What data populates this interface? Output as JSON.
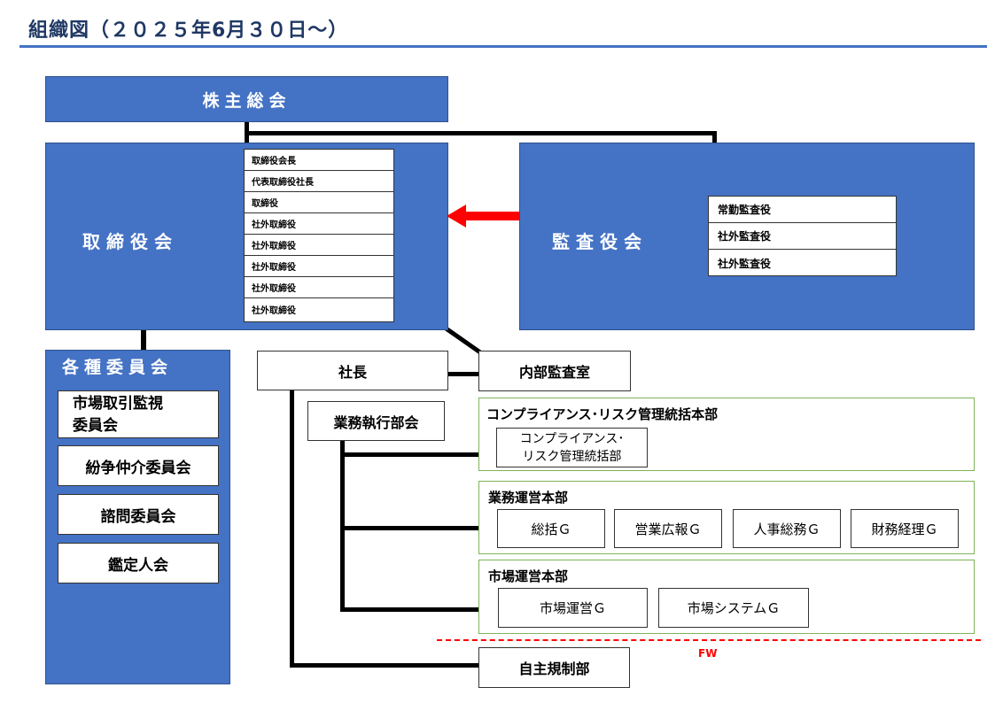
{
  "title": "組織図（２０２５年6月３０日～）",
  "shareholders": "株主総会",
  "board": {
    "label": "取締役会",
    "members": [
      "取締役会長",
      "代表取締役社長",
      "取締役",
      "社外取締役",
      "社外取締役",
      "社外取締役",
      "社外取締役",
      "社外取締役"
    ]
  },
  "audit_board": {
    "label": "監査役会",
    "members": [
      "常勤監査役",
      "社外監査役",
      "社外監査役"
    ]
  },
  "committees": {
    "label": "各種委員会",
    "items": [
      "市場取引監視\n委員会",
      "紛争仲介委員会",
      "諮問委員会",
      "鑑定人会"
    ]
  },
  "president": "社長",
  "internal_audit": "内部監査室",
  "exec_committee": "業務執行部会",
  "compliance": {
    "title": "コンプライアンス･リスク管理統括本部",
    "sub": "コンプライアンス･\nリスク管理統括部"
  },
  "operations": {
    "title": "業務運営本部",
    "groups": [
      "総括Ｇ",
      "営業広報Ｇ",
      "人事総務Ｇ",
      "財務経理Ｇ"
    ]
  },
  "market": {
    "title": "市場運営本部",
    "groups": [
      "市場運営Ｇ",
      "市場システムＧ"
    ]
  },
  "fw_label": "FW",
  "self_regulation": "自主規制部",
  "colors": {
    "box_blue": "#4472c4",
    "arrow_red": "#ff0000",
    "group_border": "#7fb357",
    "title_text": "#1f3864"
  }
}
